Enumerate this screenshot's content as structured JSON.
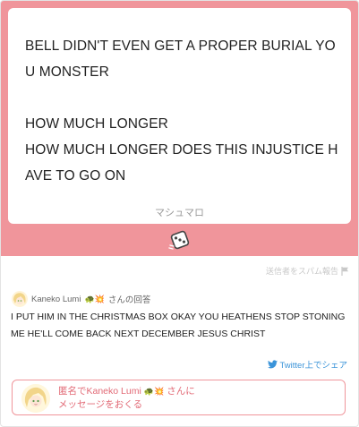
{
  "question": {
    "lines": [
      "BELL DIDN'T EVEN GET A PROPER BURIAL YOU MONSTER",
      "",
      "HOW MUCH LONGER",
      "HOW MUCH LONGER DOES THIS INJUSTICE HAVE TO GO ON"
    ],
    "brand": "マシュマロ"
  },
  "report": {
    "label": "送信者をスパム報告"
  },
  "answer": {
    "author": "Kaneko Lumi",
    "author_emoji": "🐢💥",
    "suffix": "さんの回答",
    "text": "I PUT HIM IN THE CHRISTMAS BOX OKAY YOU HEATHENS STOP STONING ME HE'LL COME BACK NEXT DECEMBER JESUS CHRIST"
  },
  "share": {
    "label": "Twitter上でシェア"
  },
  "send": {
    "prefix": "匿名でKaneko Lumi",
    "emoji": "🐢💥",
    "suffix": "さんに",
    "line2": "メッセージをおくる"
  },
  "colors": {
    "accent": "#f0959b",
    "twitter": "#3b94d9",
    "send_text": "#e26a76"
  },
  "icons": [
    "dice-icon",
    "flag-icon",
    "avatar-image",
    "twitter-bird-icon"
  ]
}
